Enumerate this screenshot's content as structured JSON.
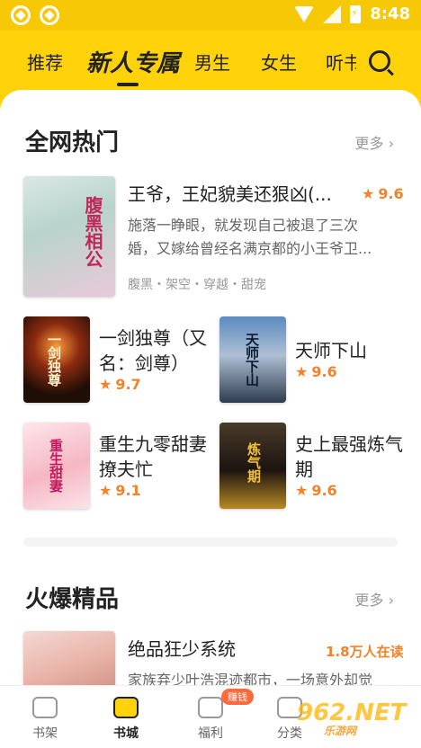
{
  "status": {
    "time": "8:48"
  },
  "tabs": [
    "推荐",
    "新人专属",
    "男生",
    "女生",
    "听书"
  ],
  "sections": {
    "hot": {
      "title": "全网热门",
      "more": "更多 ›"
    },
    "boutique": {
      "title": "火爆精品",
      "more": "更多 ›"
    }
  },
  "featured": {
    "title": "王爷，王妃貌美还狠凶(...",
    "rating": "9.6",
    "desc": [
      "施落一睁眼，就发现自己被退了三次",
      "婚，又嫁给曾经名满京都的小王爷卫..."
    ],
    "tags": "腹黑・架空・穿越・甜宠",
    "cover_text": "腹黑相公"
  },
  "grid": [
    {
      "title": [
        "一剑独尊（又",
        "名：剑尊）"
      ],
      "rating": "9.7",
      "cover_text": "一剑独尊"
    },
    {
      "title": [
        "天师下山"
      ],
      "rating": "9.6",
      "cover_text": "天师下山"
    },
    {
      "title": [
        "重生九零甜妻",
        "撩夫忙"
      ],
      "rating": "9.1",
      "cover_text": "重生甜妻"
    },
    {
      "title": [
        "史上最强炼气",
        "期"
      ],
      "rating": "9.6",
      "cover_text": "炼气期"
    }
  ],
  "boutique_book": {
    "title": "绝品狂少系统",
    "reads": "1.8万人在读",
    "desc": "家族弃少叶浩混迹都市，一场意外却觉"
  },
  "bottom_nav": [
    "书架",
    "书城",
    "福利",
    "分类"
  ],
  "badge": "赚钱",
  "watermark": {
    "main": "962.NET",
    "sub": "乐游网"
  },
  "colors": {
    "brand": "#ffd20a",
    "accent": "#f5822a"
  }
}
